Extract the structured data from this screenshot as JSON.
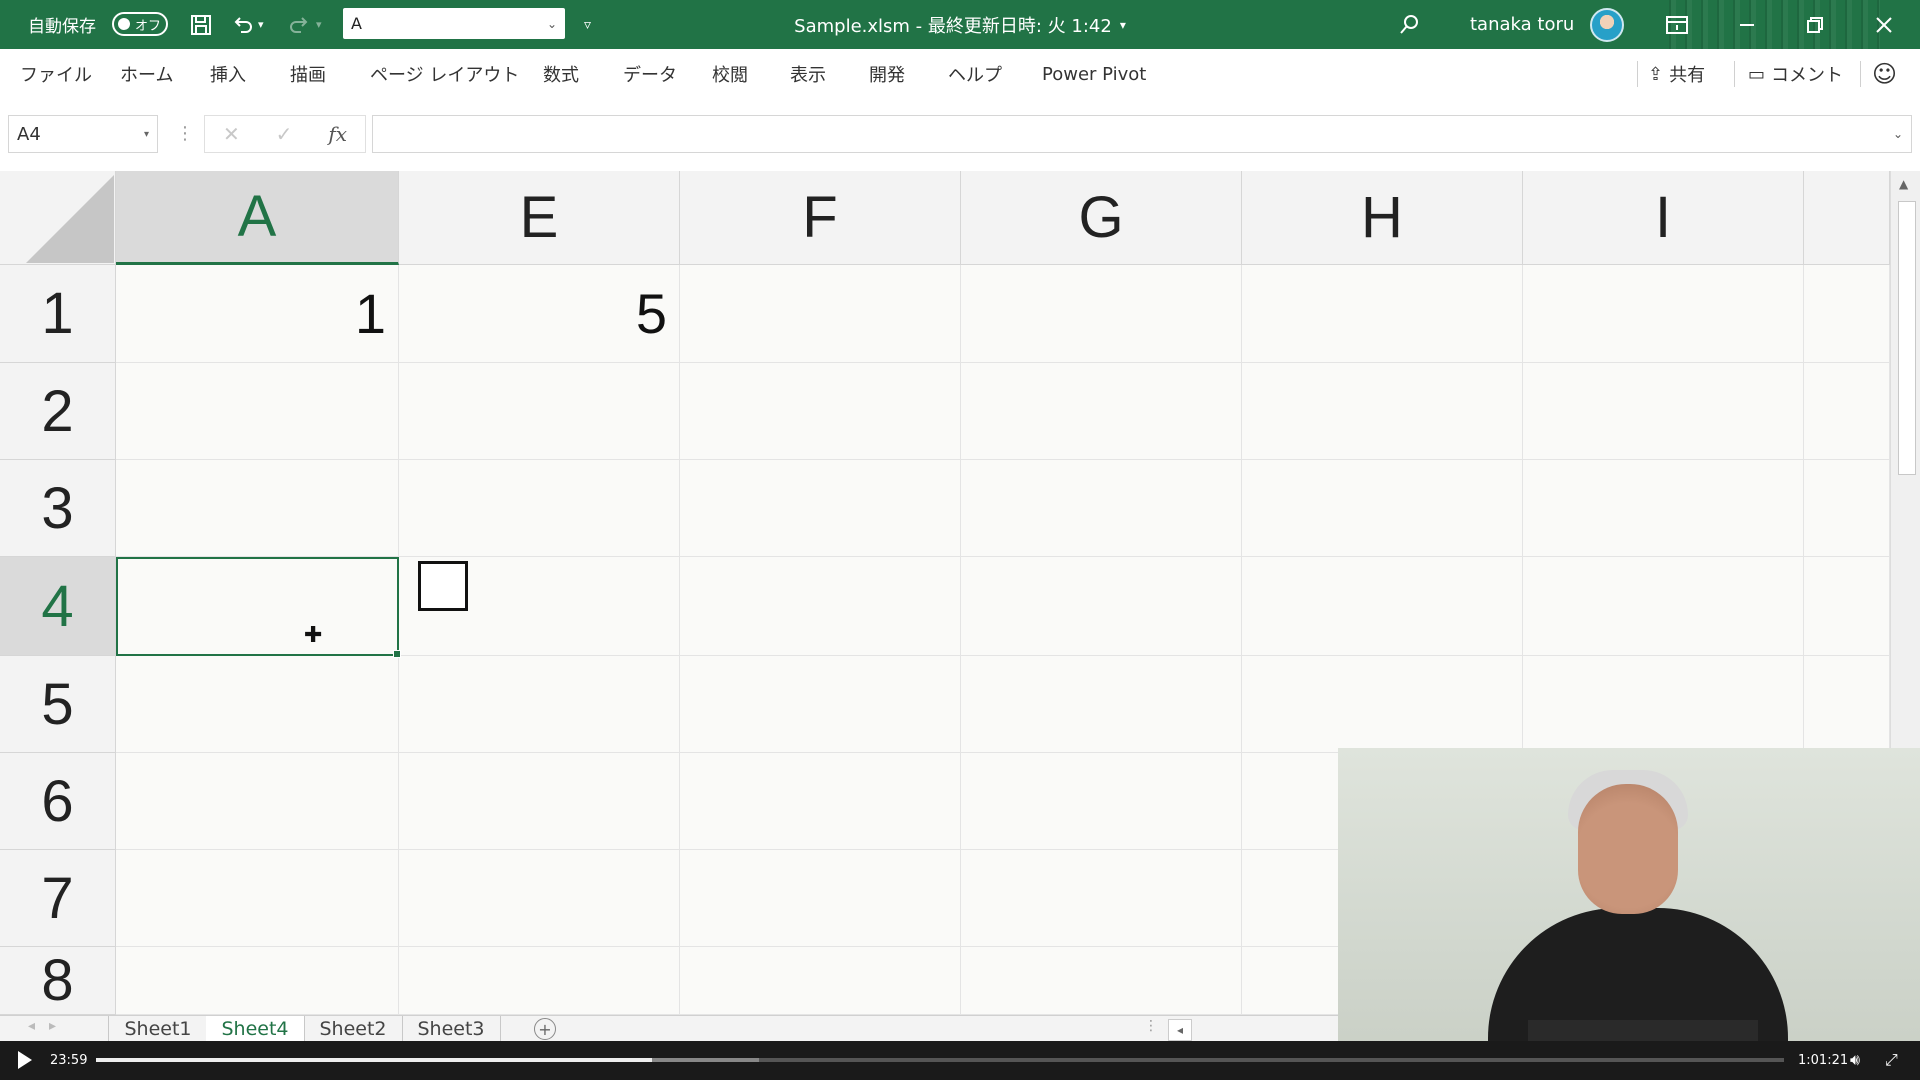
{
  "titlebar": {
    "autosave_label": "自動保存",
    "autosave_state": "オフ",
    "quick_access_value": "A",
    "document_title": "Sample.xlsm - 最終更新日時: 火 1:42",
    "user_name": "tanaka toru",
    "icons": [
      "save-icon",
      "undo-icon",
      "redo-icon",
      "customize-qat-icon",
      "search-icon",
      "ribbon-display-icon",
      "minimize-icon",
      "restore-icon",
      "close-icon"
    ]
  },
  "ribbon": {
    "tabs": [
      "ファイル",
      "ホーム",
      "挿入",
      "描画",
      "ページ レイアウト",
      "数式",
      "データ",
      "校閲",
      "表示",
      "開発",
      "ヘルプ",
      "Power Pivot"
    ],
    "share_label": "共有",
    "comment_label": "コメント"
  },
  "formula_bar": {
    "name_box": "A4",
    "fx_label": "fx",
    "formula_value": ""
  },
  "grid": {
    "columns": [
      "A",
      "E",
      "F",
      "G",
      "H",
      "I"
    ],
    "rows": [
      "1",
      "2",
      "3",
      "4",
      "5",
      "6",
      "7",
      "8"
    ],
    "active_column": "A",
    "active_row": "4",
    "cells": {
      "A1": "1",
      "E1": "5"
    },
    "checkbox_in": "E2"
  },
  "sheets": {
    "tabs": [
      "Sheet1",
      "Sheet4",
      "Sheet2",
      "Sheet3"
    ],
    "active": "Sheet4"
  },
  "video": {
    "current_time": "23:59",
    "total_time": "1:01:21",
    "progress": 0.3928,
    "buffered": 0.3296
  },
  "colors": {
    "excel_green": "#217346",
    "video_bar": "#1a1a1a"
  }
}
